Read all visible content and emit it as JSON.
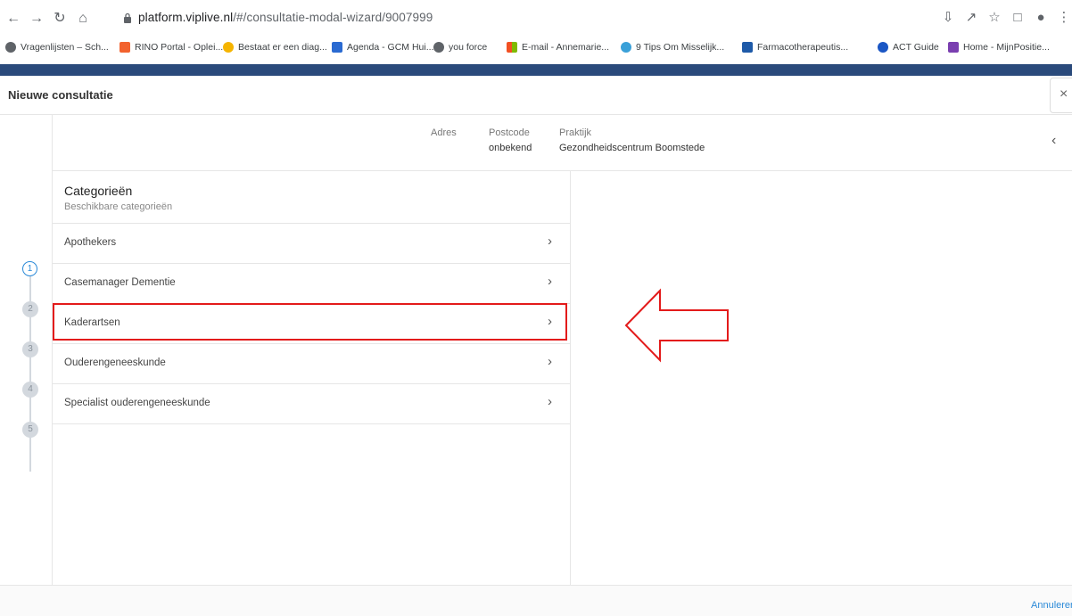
{
  "browser": {
    "url_host": "platform.viplive.nl",
    "url_path": "/#/consultatie-modal-wizard/9007999",
    "bookmarks": [
      {
        "label": "Vragenlijsten – Sch...",
        "color": "#5f6368"
      },
      {
        "label": "RINO Portal - Oplei...",
        "color": "#f2622e"
      },
      {
        "label": "Bestaat er een diag...",
        "color": "#f5b400"
      },
      {
        "label": "Agenda - GCM Hui...",
        "color": "#2a6ad1"
      },
      {
        "label": "you force",
        "color": "#5f6368"
      },
      {
        "label": "E-mail - Annemarie...",
        "color": "#f25022"
      },
      {
        "label": "9 Tips Om Misselijk...",
        "color": "#3aa0d8"
      },
      {
        "label": "Farmacotherapeutis...",
        "color": "#1e5aa8"
      },
      {
        "label": "ACT Guide",
        "color": "#1a56c4"
      },
      {
        "label": "Home - MijnPositie...",
        "color": "#7a3fb0"
      }
    ]
  },
  "modal": {
    "title": "Nieuwe consultatie",
    "close_icon": "×",
    "steps": [
      "1",
      "2",
      "3",
      "4",
      "5"
    ],
    "active_step": 1,
    "info": {
      "adres_label": "Adres",
      "postcode_label": "Postcode",
      "postcode_value": "onbekend",
      "praktijk_label": "Praktijk",
      "praktijk_value": "Gezondheidscentrum Boomstede"
    },
    "categories": {
      "title": "Categorieën",
      "subtitle": "Beschikbare categorieën",
      "items": [
        "Apothekers",
        "Casemanager Dementie",
        "Kaderartsen",
        "Ouderengeneeskunde",
        "Specialist ouderengeneeskunde"
      ],
      "highlighted_index": 2
    },
    "footer": {
      "cancel_label": "Annuleren"
    }
  },
  "colors": {
    "accent": "#2b8ad8",
    "annotation_red": "#e31b1b",
    "topbar": "#2a4a7b"
  }
}
